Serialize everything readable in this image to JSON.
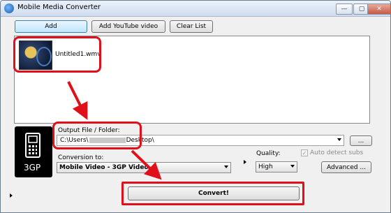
{
  "window": {
    "title": "Mobile Media Converter"
  },
  "titlebar": {
    "minimize": "—",
    "maximize": "▢",
    "close": "✕"
  },
  "toolbar": {
    "add_label": "Add",
    "youtube_label": "Add YouTube video",
    "clear_label": "Clear List"
  },
  "files": [
    {
      "name": "Untitled1.wmv"
    }
  ],
  "format": {
    "badge": "3GP"
  },
  "output": {
    "label": "Output File / Folder:",
    "path_start": "C:\\Users\\",
    "path_end": "Desktop\\",
    "browse_label": "..."
  },
  "conversion": {
    "label": "Conversion to:",
    "selected": "Mobile Video - 3GP Video"
  },
  "quality": {
    "label": "Quality:",
    "selected": "High"
  },
  "subs": {
    "label": "Auto detect subs",
    "checked": true,
    "enabled": false
  },
  "advanced_label": "Advanced ...",
  "convert_label": "Convert!",
  "annotation_color": "#e0101a"
}
